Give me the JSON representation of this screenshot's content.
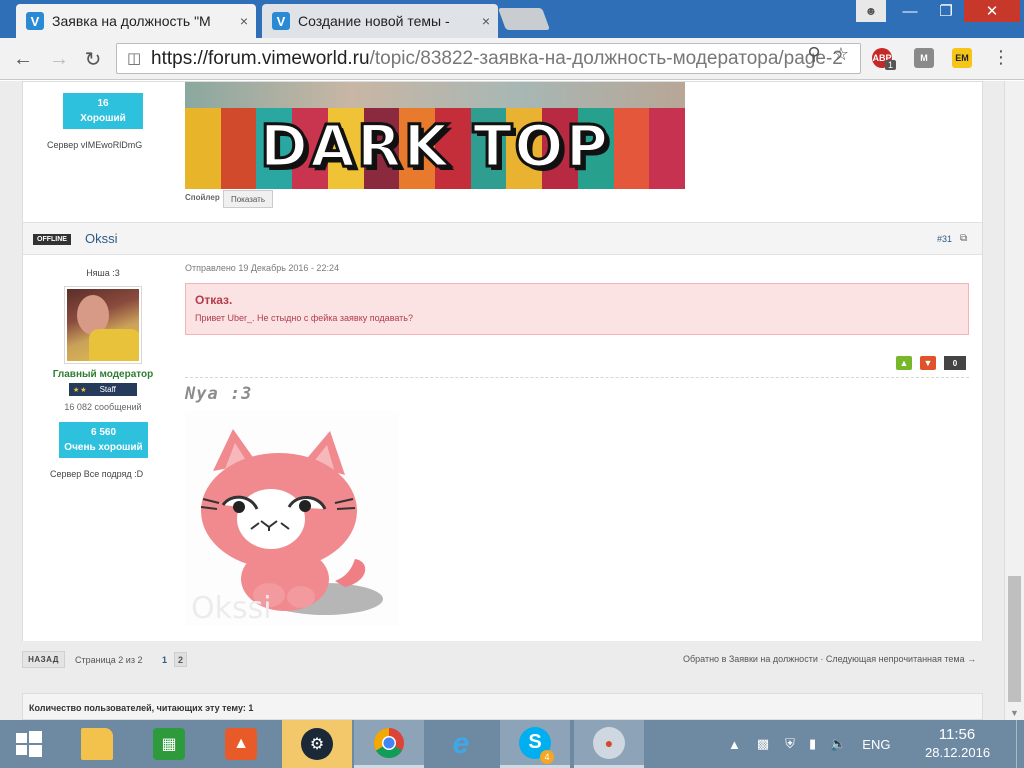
{
  "browser": {
    "tabs": [
      {
        "title": "Заявка на должность \"М",
        "close": "×"
      },
      {
        "title": "Создание новой темы -",
        "close": "×"
      }
    ],
    "url_host": "https://forum.vimeworld.ru",
    "url_path": "/topic/83822-заявка-на-должность-модератора/page-2",
    "extensions": {
      "abp": "ABP",
      "abp_count": "1",
      "m": "M",
      "em": "EM"
    }
  },
  "previous_post": {
    "reputation_value": "16",
    "reputation_label": "Хороший",
    "server": "Сервер vIMEwoRlDmG",
    "banner_text": "DARK TOP",
    "spoiler_label": "Спойлер",
    "spoiler_button": "Показать"
  },
  "post": {
    "status": "OFFLINE",
    "author": "Okssi",
    "number": "#31",
    "user_title": "Няша :3",
    "group": "Главный модератор",
    "stars": "★★",
    "badge": "Staff",
    "messages": "16 082 сообщений",
    "reputation_value": "6 560",
    "reputation_label": "Очень хороший",
    "server": "Сервер Все подряд :D",
    "posted": "Отправлено 19 Декабрь 2016 - 22:24",
    "refusal_title": "Отказ.",
    "refusal_text": "Привет Uber_. Не стыдно с фейка заявку подавать?",
    "rep_count": "0",
    "signature": "Nya :3",
    "signature_watermark": "Okssi"
  },
  "pagination": {
    "back": "НАЗАД",
    "info": "Страница 2 из 2",
    "pages": [
      "1",
      "2"
    ],
    "footer_link": "Обратно в Заявки на должности · Следующая непрочитанная тема →"
  },
  "readers": "Количество пользователей, читающих эту тему: 1",
  "taskbar": {
    "language": "ENG",
    "time": "11:56",
    "date": "28.12.2016",
    "skype_badge": "4"
  },
  "colors": {
    "chrome_frame": "#2f6fb8",
    "reputation": "#2ec1dd",
    "refusal_bg": "#fbe3e4",
    "refusal_text": "#b23b4b",
    "group_green": "#2e7d32",
    "taskbar": "#6e8aa3"
  }
}
